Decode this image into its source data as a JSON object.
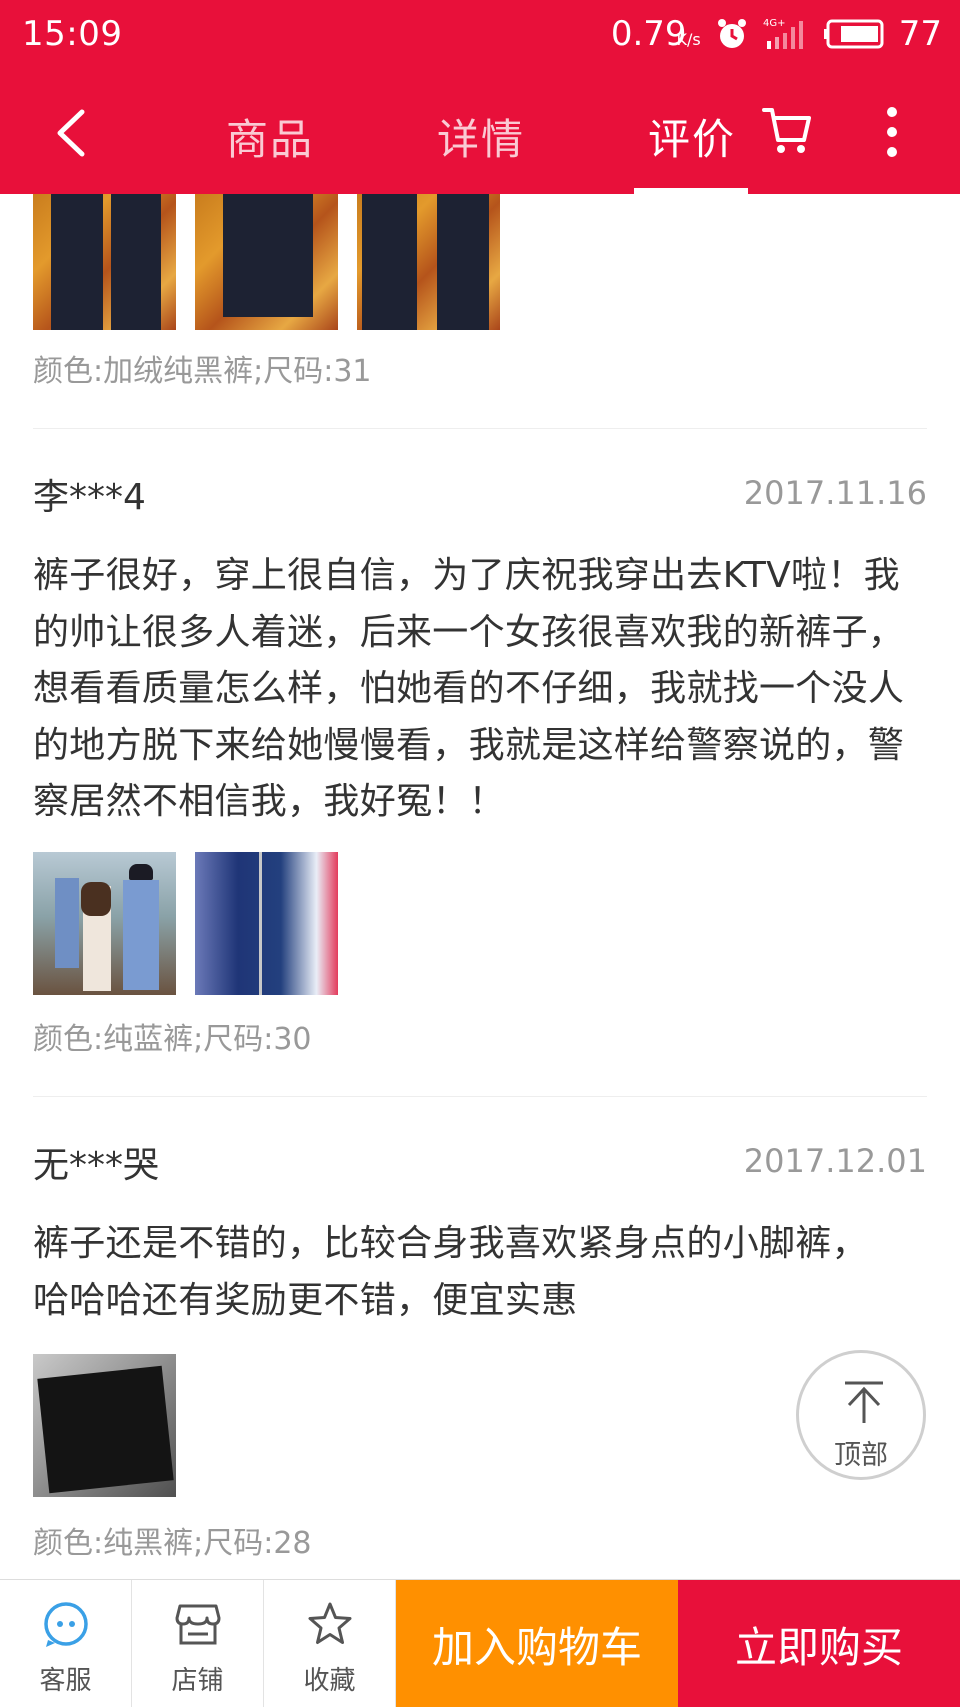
{
  "status_bar": {
    "time": "15:09",
    "net_speed": "0.79",
    "net_speed_unit": "K/s",
    "network_type": "4G+",
    "battery": "77",
    "icons": [
      "alarm-icon",
      "signal-icon",
      "battery-icon"
    ]
  },
  "nav": {
    "tabs": [
      {
        "label": "商品",
        "active": false
      },
      {
        "label": "详情",
        "active": false
      },
      {
        "label": "评价",
        "active": true
      }
    ],
    "icons": [
      "back-arrow-icon",
      "cart-icon",
      "more-vertical-icon"
    ]
  },
  "reviews": [
    {
      "user": "",
      "date": "",
      "text": "",
      "spec": "颜色:加绒纯黑裤;尺码:31",
      "images": [
        "jeans-photo",
        "jeans-photo",
        "jeans-photo"
      ]
    },
    {
      "user": "李***4",
      "date": "2017.11.16",
      "text": "裤子很好，穿上很自信，为了庆祝我穿出去KTV啦！我的帅让很多人着迷，后来一个女孩很喜欢我的新裤子，想看看质量怎么样，怕她看的不仔细，我就找一个没人的地方脱下来给她慢慢看，我就是这样给警察说的，警察居然不相信我，我好冤！！",
      "spec": "颜色:纯蓝裤;尺码:30",
      "images": [
        "police-photo",
        "blue-jeans-photo"
      ]
    },
    {
      "user": "无***哭",
      "date": "2017.12.01",
      "text": "裤子还是不错的，比较合身我喜欢紧身点的小脚裤，哈哈哈还有奖励更不错，便宜实惠",
      "spec": "颜色:纯黑裤;尺码:28",
      "images": [
        "black-jeans-photo"
      ]
    }
  ],
  "back_to_top": {
    "label": "顶部"
  },
  "bottom_bar": {
    "service": "客服",
    "shop": "店铺",
    "favorite": "收藏",
    "add_to_cart": "加入购物车",
    "buy_now": "立即购买"
  },
  "colors": {
    "brand_red": "#e8103a",
    "cart_orange": "#ff9000",
    "service_blue": "#3aa0e6"
  }
}
